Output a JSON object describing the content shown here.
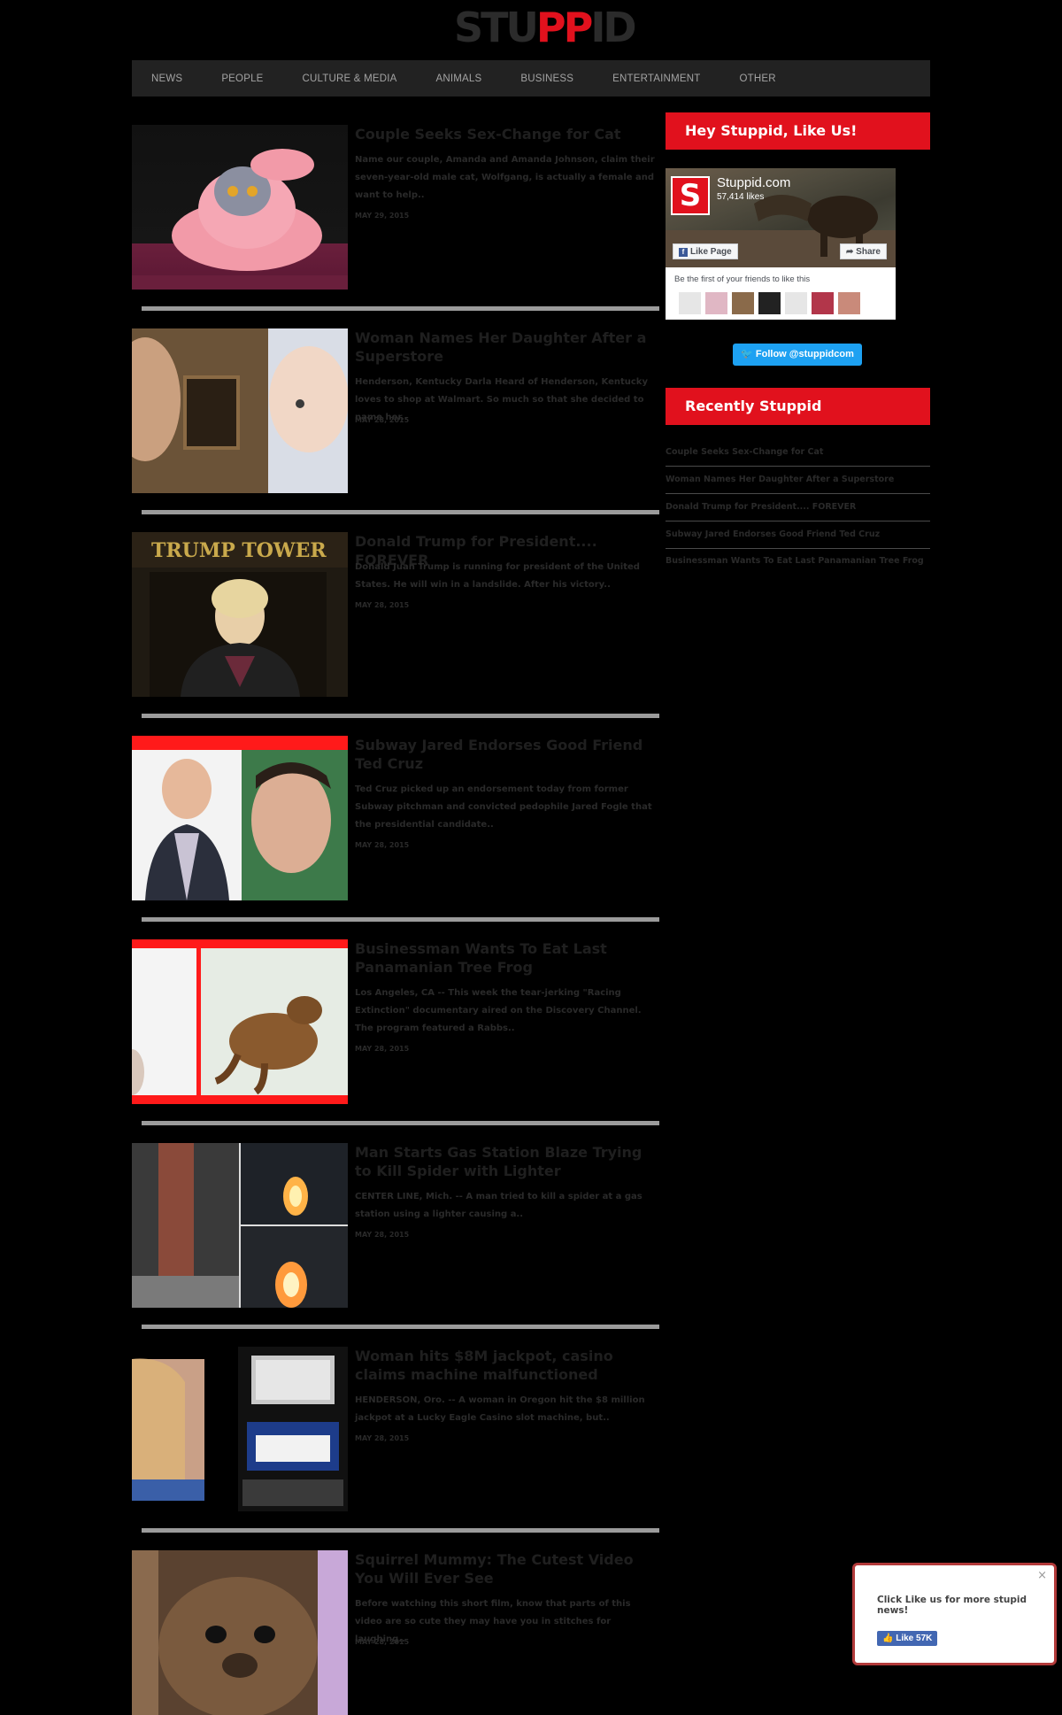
{
  "logo": {
    "part1": "STU",
    "part2": "PP",
    "part3": "ID"
  },
  "nav": [
    "NEWS",
    "PEOPLE",
    "CULTURE & MEDIA",
    "ANIMALS",
    "BUSINESS",
    "ENTERTAINMENT",
    "OTHER"
  ],
  "articles": [
    {
      "title": "Couple Seeks Sex-Change for Cat",
      "excerpt": "Name our couple, Amanda and Amanda Johnson, claim their seven-year-old male cat, Wolfgang, is actually a female and want to help..",
      "date": "MAY 29, 2015"
    },
    {
      "title": "Woman Names Her Daughter After a Superstore",
      "excerpt": "Henderson, Kentucky Darla Heard of Henderson, Kentucky loves to shop at Walmart. So much so that she decided to name her..",
      "date": "MAY 28, 2015"
    },
    {
      "title": "Donald Trump for President.... FOREVER",
      "excerpt": "Donald Juan Trump is running for president of the United States. He will win in a landslide. After his victory..",
      "date": "MAY 28, 2015"
    },
    {
      "title": "Subway Jared Endorses Good Friend Ted Cruz",
      "excerpt": "Ted Cruz picked up an endorsement today from former Subway pitchman and convicted pedophile Jared Fogle that the presidential candidate..",
      "date": "MAY 28, 2015"
    },
    {
      "title": "Businessman Wants To Eat Last Panamanian Tree Frog",
      "excerpt": "Los Angeles, CA -- This week the tear-jerking \"Racing Extinction\" documentary aired on the Discovery Channel. The program featured a Rabbs..",
      "date": "MAY 28, 2015"
    },
    {
      "title": "Man Starts Gas Station Blaze Trying to Kill Spider with Lighter",
      "excerpt": "CENTER LINE, Mich. -- A man tried to kill a spider at a gas station using a lighter causing a..",
      "date": "MAY 28, 2015"
    },
    {
      "title": "Woman hits $8M jackpot, casino claims machine malfunctioned",
      "excerpt": "HENDERSON, Oro. -- A woman in Oregon hit the $8 million jackpot at a Lucky Eagle Casino slot machine, but..",
      "date": "MAY 28, 2015"
    },
    {
      "title": "Squirrel Mummy: The Cutest Video You Will Ever See",
      "excerpt": "Before watching this short film, know that parts of this video are so cute they may have you in stitches for laughing..",
      "date": "MAY 28, 2015"
    }
  ],
  "sidebar": {
    "like_heading": "Hey Stuppid, Like Us!",
    "fb": {
      "logo_letter": "S",
      "name": "Stuppid.com",
      "likes": "57,414 likes",
      "like_btn": "Like Page",
      "share_btn": "Share",
      "friends_text": "Be the first of your friends to like this"
    },
    "twitter": "Follow @stuppidcom",
    "recent_heading": "Recently Stuppid",
    "recent": [
      "Couple Seeks Sex-Change for Cat",
      "Woman Names Her Daughter After a Superstore",
      "Donald Trump for President.... FOREVER",
      "Subway Jared Endorses Good Friend Ted Cruz",
      "Businessman Wants To Eat Last Panamanian Tree Frog"
    ]
  },
  "popup": {
    "message": "Click Like us for more stupid news!",
    "close": "×",
    "like": "Like 57K"
  }
}
